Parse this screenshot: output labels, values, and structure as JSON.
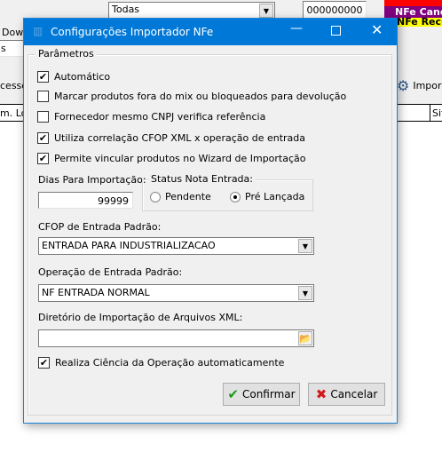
{
  "background": {
    "filter_combo": "Todas",
    "number_field": "000000000",
    "status_legend": [
      "NFe Canc",
      "NFe Recu"
    ],
    "download_button": "Down",
    "left_field": "s",
    "process_label": "cesso",
    "import_button": "Impor",
    "column_headers": [
      "m. Loj",
      "Sit"
    ]
  },
  "dialog": {
    "title": "Configurações Importador NFe",
    "group_title": "Parâmetros",
    "checkboxes": [
      {
        "label": "Automático",
        "checked": true
      },
      {
        "label": "Marcar produtos fora do mix ou bloqueados para devolução",
        "checked": false
      },
      {
        "label": "Fornecedor mesmo CNPJ verifica referência",
        "checked": false
      },
      {
        "label": "Utiliza correlação CFOP XML x operação de entrada",
        "checked": true
      },
      {
        "label": "Permite vincular produtos no Wizard de Importação",
        "checked": true
      }
    ],
    "days_label": "Dias Para Importação:",
    "days_value": "99999",
    "status_group": "Status Nota Entrada:",
    "status_options": [
      "Pendente",
      "Pré Lançada"
    ],
    "status_selected": "Pré Lançada",
    "cfop_label": "CFOP de Entrada Padrão:",
    "cfop_value": "ENTRADA PARA INDUSTRIALIZACAO",
    "operation_label": "Operação de Entrada Padrão:",
    "operation_value": "NF ENTRADA NORMAL",
    "dir_label": "Diretório de Importação de Arquivos XML:",
    "dir_value": "",
    "ciencia_label": "Realiza Ciência da Operação automaticamente",
    "ciencia_checked": true,
    "confirm_label": "Confirmar",
    "cancel_label": "Cancelar"
  }
}
